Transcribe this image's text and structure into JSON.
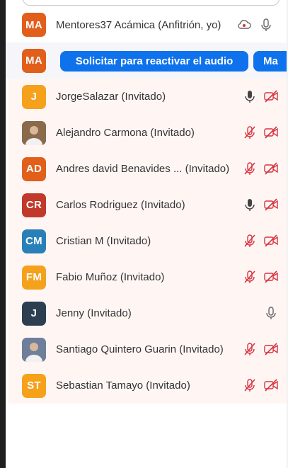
{
  "colors": {
    "button_blue": "#0e72ed",
    "muted_red": "#d9313e",
    "list_background": "#fff6f4"
  },
  "host": {
    "initials": "MA",
    "avatar_color": "#e15e1b",
    "name": "Mentores37 Acámica (Anfitrión, yo)",
    "icons": [
      "cloud-recording-icon",
      "microphone-icon"
    ]
  },
  "selected": {
    "initials": "MA",
    "avatar_color": "#e15e1b",
    "request_audio_button": "Solicitar para reactivar el audio",
    "more_button": "Ma"
  },
  "participants": [
    {
      "initials": "J",
      "avatar_color": "#f5a11c",
      "name": "JorgeSalazar (Invitado)",
      "mic": "on",
      "video": "off"
    },
    {
      "initials": "",
      "avatar_color": "#8a6a4a",
      "photo": true,
      "name": "Alejandro Carmona (Invitado)",
      "mic": "muted",
      "video": "off"
    },
    {
      "initials": "AD",
      "avatar_color": "#e15e1b",
      "name": "Andres david Benavides ...  (Invitado)",
      "mic": "muted",
      "video": "off"
    },
    {
      "initials": "CR",
      "avatar_color": "#c0392b",
      "name": "Carlos Rodriguez (Invitado)",
      "mic": "on",
      "video": "off"
    },
    {
      "initials": "CM",
      "avatar_color": "#2980b9",
      "name": "Cristian M (Invitado)",
      "mic": "muted",
      "video": "off"
    },
    {
      "initials": "FM",
      "avatar_color": "#f5a11c",
      "name": "Fabio Muñoz (Invitado)",
      "mic": "muted",
      "video": "off"
    },
    {
      "initials": "J",
      "avatar_color": "#2c3e50",
      "name": "Jenny (Invitado)",
      "mic": "on",
      "video": "none"
    },
    {
      "initials": "",
      "avatar_color": "#6d7f9a",
      "photo": true,
      "name": "Santiago Quintero Guarin (Invitado)",
      "mic": "muted",
      "video": "off"
    },
    {
      "initials": "ST",
      "avatar_color": "#f5a11c",
      "name": "Sebastian Tamayo (Invitado)",
      "mic": "muted",
      "video": "off"
    }
  ]
}
